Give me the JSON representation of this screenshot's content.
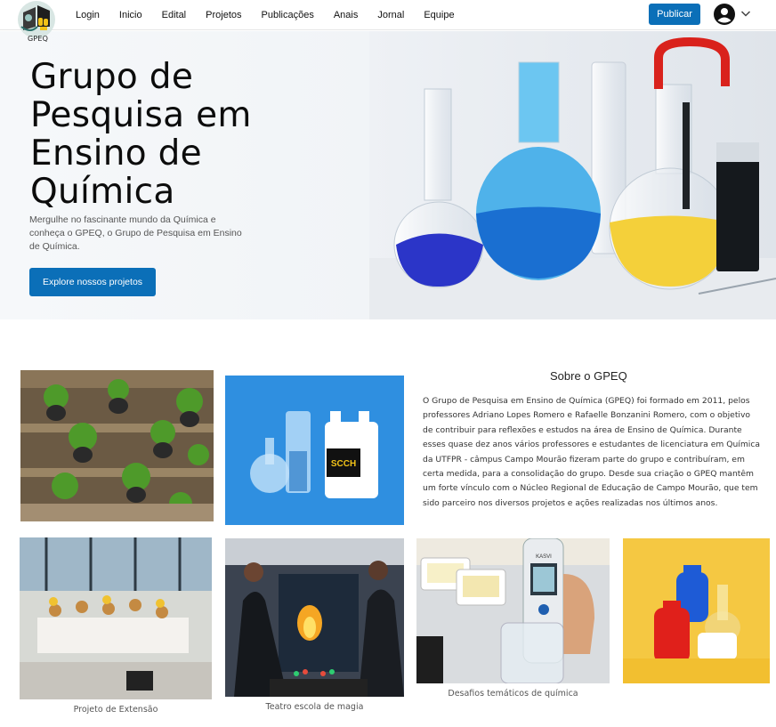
{
  "navbar": {
    "logo_text": "GPEQ",
    "links": [
      "Login",
      "Inicio",
      "Edital",
      "Projetos",
      "Publicações",
      "Anais",
      "Jornal",
      "Equipe"
    ],
    "publish_label": "Publicar"
  },
  "hero": {
    "title": "Grupo de Pesquisa em Ensino de Química",
    "description": "Mergulhe no fascinante mundo da Química e conheça o GPEQ, o Grupo de Pesquisa em Ensino de Química.",
    "cta_label": "Explore nossos projetos"
  },
  "about": {
    "title": "Sobre o GPEQ",
    "text": "O Grupo de Pesquisa em Ensino de Química (GPEQ) foi formado em 2011, pelos professores Adriano Lopes Romero e Rafaelle Bonzanini Romero, com o objetivo de contribuir para reflexões e  estudos na área de Ensino de Química. Durante esses quase dez anos vários professores e estudantes de licenciatura em Química da UTFPR - câmpus Campo Mourão fizeram parte do grupo e contribuíram, em certa medida, para a consolidação do grupo. Desde sua criação o GPEQ mantêm um forte vínculo com o Núcleo Regional de Educação de Campo Mourão, que tem sido parceiro nos diversos projetos e ações realizadas nos últimos anos."
  },
  "gallery": {
    "bottle_label": "SCCH",
    "meter_label": "KASVI",
    "captions": {
      "extensao": "Projeto de Extensão",
      "magia": "Teatro escola de magia",
      "desafios": "Desafios temáticos de química"
    }
  },
  "colors": {
    "primary": "#0b6fb8",
    "hero_bg": "#f5f7fa"
  }
}
